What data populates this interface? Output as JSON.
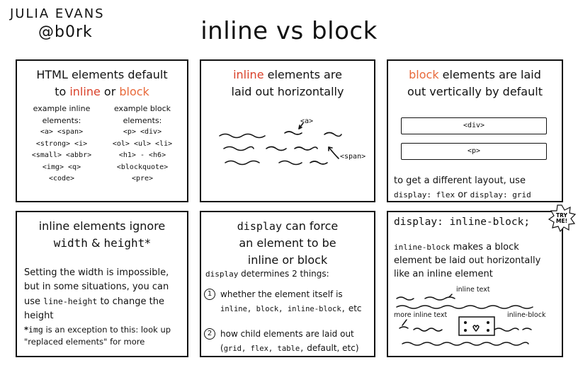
{
  "author": {
    "name": "JULIA EVANS",
    "handle": "@b0rk"
  },
  "title": "inline vs block",
  "panel1": {
    "title_line1": "HTML elements default",
    "title_to": "to ",
    "title_inline": "inline",
    "title_or": " or ",
    "title_block": "block",
    "inline_header": "example inline elements:",
    "inline_items": [
      "<a> <span>",
      "<strong> <i>",
      "<small> <abbr>",
      "<img> <q>",
      "<code>"
    ],
    "block_header": "example block elements:",
    "block_items": [
      "<p> <div>",
      "<ol> <ul> <li>",
      "<h1> - <h6>",
      "<blockquote>",
      "<pre>"
    ]
  },
  "panel2": {
    "title_inline": "inline",
    "title_rest1": " elements are",
    "title_line2": "laid out horizontally",
    "tag_a": "<a>",
    "tag_span": "<span>"
  },
  "panel3": {
    "title_block": "block",
    "title_rest1": " elements are laid",
    "title_line2": "out vertically by default",
    "box1": "<div>",
    "box2": "<p>",
    "note_line1": "to get a different layout, use",
    "note_code1": "display: flex",
    "note_or": " or ",
    "note_code2": "display: grid"
  },
  "panel4": {
    "title_line1": "inline elements ignore",
    "title_width": "width",
    "title_amp": " & ",
    "title_height": "height",
    "title_star": "*",
    "body_part1": "Setting the width is impossible, but in some situations, you can use ",
    "body_code": "line-height",
    "body_part2": " to change the height",
    "foot_star": "*",
    "foot_code": "img",
    "foot_text": " is an exception to this: look up \"replaced elements\" for more"
  },
  "panel5": {
    "title_code": "display",
    "title_rest1": " can force",
    "title_line2": "an element to be",
    "title_line3": "inline or block",
    "sub_code": "display",
    "sub_text": " determines 2 things:",
    "item1_num": "1",
    "item1_text": "whether the element itself is",
    "item1_code": "inline, block, inline-block,",
    "item1_etc": " etc",
    "item2_num": "2",
    "item2_text": "how child elements are laid out",
    "item2_open": "(",
    "item2_code": "grid, flex, table,",
    "item2_default": " default,",
    "item2_close": " etc)"
  },
  "panel6": {
    "head": "display: inline-block;",
    "desc_code": "inline-block",
    "desc_text": " makes a block element be laid out horizontally like an inline element",
    "label_inline": "inline text",
    "label_more": "more inline text",
    "label_ib": "inline-block"
  },
  "tryme": {
    "line1": "TRY",
    "line2": "ME!"
  }
}
